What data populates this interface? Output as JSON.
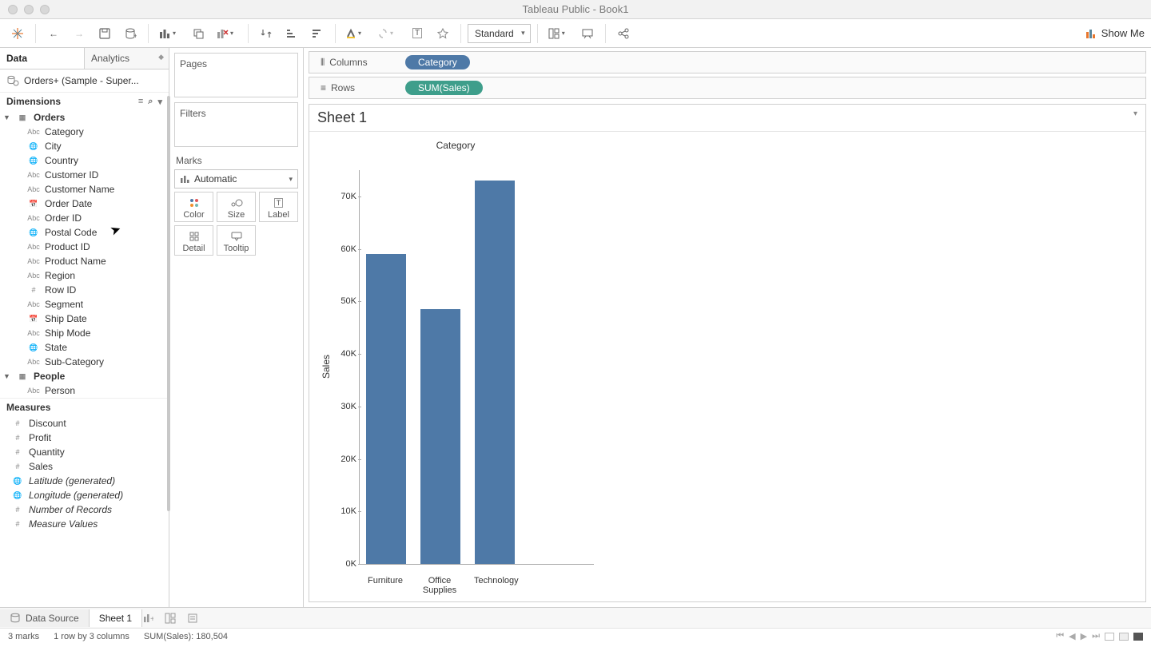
{
  "window": {
    "title": "Tableau Public - Book1"
  },
  "toolbar": {
    "fit_mode": "Standard",
    "showme_label": "Show Me"
  },
  "datapane": {
    "tabs": {
      "data": "Data",
      "analytics": "Analytics"
    },
    "datasource": "Orders+ (Sample - Super...",
    "dimensions_label": "Dimensions",
    "measures_label": "Measures",
    "groups": [
      {
        "name": "Orders",
        "items": [
          {
            "icon": "Abc",
            "label": "Category"
          },
          {
            "icon": "globe",
            "label": "City"
          },
          {
            "icon": "globe",
            "label": "Country"
          },
          {
            "icon": "Abc",
            "label": "Customer ID"
          },
          {
            "icon": "Abc",
            "label": "Customer Name"
          },
          {
            "icon": "date",
            "label": "Order Date"
          },
          {
            "icon": "Abc",
            "label": "Order ID"
          },
          {
            "icon": "globe",
            "label": "Postal Code"
          },
          {
            "icon": "Abc",
            "label": "Product ID"
          },
          {
            "icon": "Abc",
            "label": "Product Name"
          },
          {
            "icon": "Abc",
            "label": "Region"
          },
          {
            "icon": "num",
            "label": "Row ID"
          },
          {
            "icon": "Abc",
            "label": "Segment"
          },
          {
            "icon": "date",
            "label": "Ship Date"
          },
          {
            "icon": "Abc",
            "label": "Ship Mode"
          },
          {
            "icon": "globe",
            "label": "State"
          },
          {
            "icon": "Abc",
            "label": "Sub-Category"
          }
        ]
      },
      {
        "name": "People",
        "items": [
          {
            "icon": "Abc",
            "label": "Person"
          }
        ]
      }
    ],
    "measures": [
      {
        "icon": "num",
        "label": "Discount"
      },
      {
        "icon": "num",
        "label": "Profit"
      },
      {
        "icon": "num",
        "label": "Quantity"
      },
      {
        "icon": "num",
        "label": "Sales"
      },
      {
        "icon": "globe",
        "label": "Latitude (generated)",
        "italic": true
      },
      {
        "icon": "globe",
        "label": "Longitude (generated)",
        "italic": true
      },
      {
        "icon": "num",
        "label": "Number of Records",
        "italic": true
      },
      {
        "icon": "num",
        "label": "Measure Values",
        "italic": true
      }
    ]
  },
  "shelves": {
    "pages": "Pages",
    "filters": "Filters",
    "marks": "Marks",
    "mark_type": "Automatic",
    "cards": {
      "color": "Color",
      "size": "Size",
      "label": "Label",
      "detail": "Detail",
      "tooltip": "Tooltip"
    },
    "columns_label": "Columns",
    "rows_label": "Rows",
    "columns_pill": "Category",
    "rows_pill": "SUM(Sales)"
  },
  "sheet": {
    "title": "Sheet 1"
  },
  "footer": {
    "datasource": "Data Source",
    "sheet": "Sheet 1"
  },
  "status": {
    "marks": "3 marks",
    "dims": "1 row by 3 columns",
    "agg": "SUM(Sales): 180,504"
  },
  "chart_data": {
    "type": "bar",
    "title": "Category",
    "ylabel": "Sales",
    "ylim": [
      0,
      75000
    ],
    "yticks": [
      0,
      10000,
      20000,
      30000,
      40000,
      50000,
      60000,
      70000
    ],
    "ytick_labels": [
      "0K",
      "10K",
      "20K",
      "30K",
      "40K",
      "50K",
      "60K",
      "70K"
    ],
    "categories": [
      "Furniture",
      "Office Supplies",
      "Technology"
    ],
    "values": [
      59000,
      48500,
      73000
    ]
  }
}
